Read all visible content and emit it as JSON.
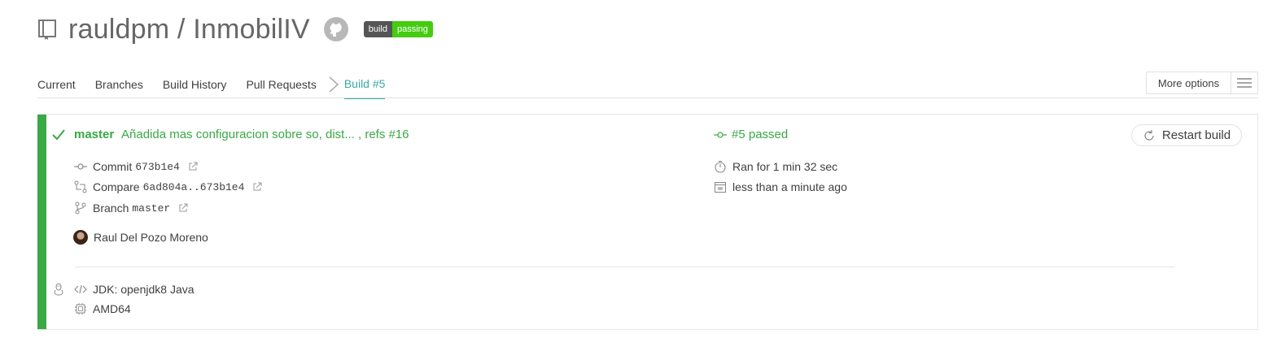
{
  "header": {
    "repo_owner": "rauldpm",
    "repo_separator": " / ",
    "repo_name": "InmobilIV",
    "badge_left": "build",
    "badge_right": "passing"
  },
  "tabs": [
    {
      "label": "Current"
    },
    {
      "label": "Branches"
    },
    {
      "label": "Build History"
    },
    {
      "label": "Pull Requests"
    },
    {
      "label": "Build #5",
      "active": true
    }
  ],
  "more_options": {
    "label": "More options"
  },
  "build": {
    "branch": "master",
    "message": "Añadida mas configuracion sobre so, dist... , refs #16",
    "status": "#5 passed",
    "restart_label": "Restart build",
    "commit_label": "Commit",
    "commit_sha": "673b1e4",
    "compare_label": "Compare",
    "compare_range": "6ad804a..673b1e4",
    "branch_label": "Branch",
    "branch_value": "master",
    "duration": "Ran for 1 min 32 sec",
    "finished": "less than a minute ago",
    "author": "Raul Del Pozo Moreno",
    "jdk": "JDK: openjdk8 Java",
    "arch": "AMD64"
  },
  "colors": {
    "passed": "#39a845",
    "accent": "#39aaa4",
    "badge_pass": "#44cc11",
    "badge_dark": "#555555"
  },
  "icons": [
    "repo-icon",
    "github-icon",
    "check-icon",
    "commit-icon",
    "compare-icon",
    "branch-icon",
    "external-link-icon",
    "timer-icon",
    "calendar-icon",
    "restart-icon",
    "code-icon",
    "cpu-icon",
    "linux-icon",
    "hamburger-icon"
  ]
}
